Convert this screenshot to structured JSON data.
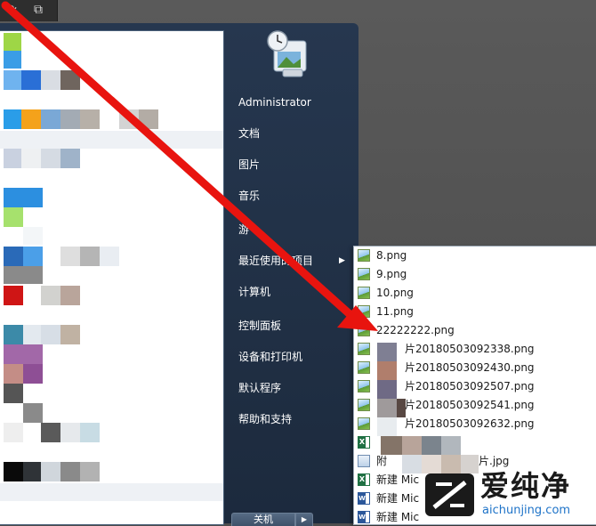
{
  "start_menu": {
    "user_name": "Administrator",
    "items": [
      {
        "label": "文档"
      },
      {
        "label": "图片"
      },
      {
        "label": "音乐"
      },
      {
        "label": "游"
      },
      {
        "label": "最近使用的项目"
      },
      {
        "label": "计算机"
      },
      {
        "label": "控制面板"
      },
      {
        "label": "设备和打印机"
      },
      {
        "label": "默认程序"
      },
      {
        "label": "帮助和支持"
      }
    ],
    "shutdown_label": "关机"
  },
  "recent_items": {
    "files": [
      {
        "name": "8.png",
        "icon": "image-file-icon"
      },
      {
        "name": "9.png",
        "icon": "image-file-icon"
      },
      {
        "name": "10.png",
        "icon": "image-file-icon"
      },
      {
        "name": "11.png",
        "icon": "image-file-icon"
      },
      {
        "name": "22222222.png",
        "icon": "image-file-icon"
      },
      {
        "name": "片20180503092338.png",
        "icon": "image-file-icon"
      },
      {
        "name": "片20180503092430.png",
        "icon": "image-file-icon"
      },
      {
        "name": "片20180503092507.png",
        "icon": "image-file-icon"
      },
      {
        "name": "片20180503092541.png",
        "icon": "image-file-icon"
      },
      {
        "name": "片20180503092632.png",
        "icon": "image-file-icon"
      },
      {
        "name": "",
        "icon": "excel-file-icon"
      },
      {
        "name": "附",
        "suffix": "片.jpg",
        "icon": "image-doc-icon"
      },
      {
        "name": "新建 Mic",
        "icon": "excel-file-icon"
      },
      {
        "name": "新建 Mic",
        "icon": "word-file-icon"
      },
      {
        "name": "新建 Mic",
        "icon": "word-file-icon"
      }
    ]
  },
  "watermark": {
    "title": "爱纯净",
    "url": "aichunjing.com"
  },
  "colors": {
    "menu_bg": "#223248",
    "arrow": "#e8140f",
    "watermark_url": "#1e73c8"
  }
}
